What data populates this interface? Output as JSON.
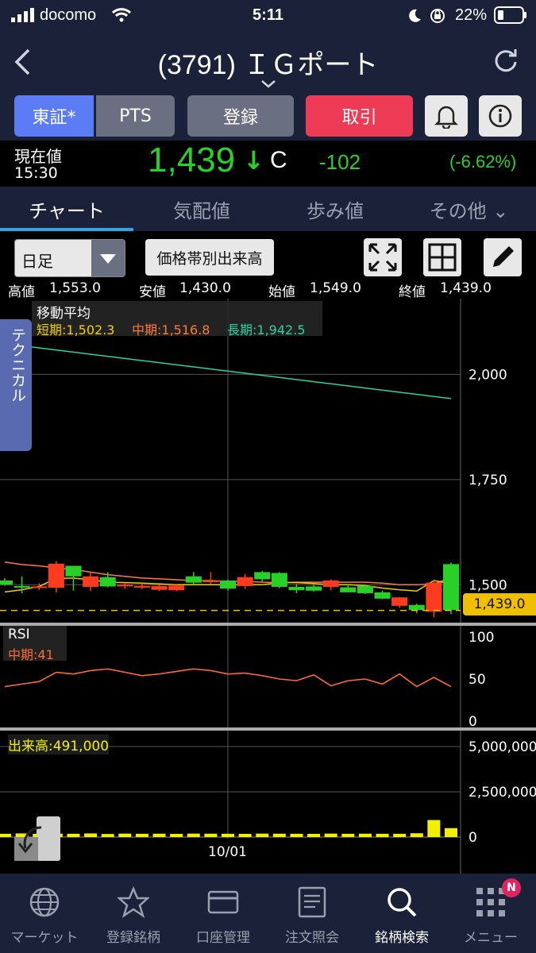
{
  "status": {
    "carrier": "docomo",
    "time": "5:11",
    "battery": "22%"
  },
  "nav": {
    "title": "(3791) ＩＧポート"
  },
  "buttons": {
    "market": "東証*",
    "pts": "PTS",
    "register": "登録",
    "trade": "取引"
  },
  "price": {
    "label": "現在値",
    "time": "15:30",
    "value": "1,439",
    "arrow": "↓",
    "flag": "C",
    "change": "-102",
    "change_pct": "(-6.62%)"
  },
  "tabs": [
    "チャート",
    "気配値",
    "歩み値",
    "その他 ⌄"
  ],
  "toolbar": {
    "period": "日足",
    "volume_profile": "価格帯別出来高"
  },
  "ohlc": {
    "high_label": "高値",
    "high": "1,553.0",
    "low_label": "安値",
    "low": "1,430.0",
    "open_label": "始値",
    "open": "1,549.0",
    "close_label": "終値",
    "close": "1,439.0"
  },
  "technical_tab": "テクニカル",
  "ma": {
    "title": "移動平均",
    "short": "短期:1,502.3",
    "mid": "中期:1,516.8",
    "long": "長期:1,942.5"
  },
  "rsi": {
    "title": "RSI",
    "mid": "中期:41"
  },
  "volume": {
    "label": "出来高:491,000"
  },
  "x_label": "10/01",
  "colors": {
    "up": "#28d028",
    "down": "#ff3b1f",
    "ma_short": "#f0d000",
    "ma_mid": "#ff7a3a",
    "ma_long": "#2ad3a0",
    "rsi": "#ff6a30",
    "volume": "#f0f000",
    "accent": "#5b7cf5",
    "trade": "#ee3b55"
  },
  "chart_data": [
    {
      "type": "candlestick",
      "ylim": [
        1410,
        2180
      ],
      "yticks": [
        "2,000",
        "1,750",
        "1,500"
      ],
      "current_price_label": "1,439.0",
      "candles": [
        {
          "o": 1510,
          "h": 1516,
          "l": 1498,
          "c": 1500,
          "up": true
        },
        {
          "o": 1495,
          "h": 1520,
          "l": 1480,
          "c": 1497,
          "up": true
        },
        {
          "o": 1496,
          "h": 1503,
          "l": 1488,
          "c": 1495,
          "up": false
        },
        {
          "o": 1550,
          "h": 1556,
          "l": 1482,
          "c": 1493,
          "up": false
        },
        {
          "o": 1520,
          "h": 1532,
          "l": 1486,
          "c": 1545,
          "up": true
        },
        {
          "o": 1520,
          "h": 1530,
          "l": 1485,
          "c": 1495,
          "up": false
        },
        {
          "o": 1496,
          "h": 1530,
          "l": 1494,
          "c": 1518,
          "up": true
        },
        {
          "o": 1500,
          "h": 1504,
          "l": 1490,
          "c": 1497,
          "up": false
        },
        {
          "o": 1495,
          "h": 1503,
          "l": 1490,
          "c": 1497,
          "up": false
        },
        {
          "o": 1497,
          "h": 1500,
          "l": 1485,
          "c": 1488,
          "up": false
        },
        {
          "o": 1498,
          "h": 1502,
          "l": 1485,
          "c": 1487,
          "up": false
        },
        {
          "o": 1505,
          "h": 1530,
          "l": 1500,
          "c": 1520,
          "up": true
        },
        {
          "o": 1510,
          "h": 1530,
          "l": 1502,
          "c": 1508,
          "up": false
        },
        {
          "o": 1510,
          "h": 1512,
          "l": 1486,
          "c": 1491,
          "up": true
        },
        {
          "o": 1518,
          "h": 1526,
          "l": 1490,
          "c": 1497,
          "up": false
        },
        {
          "o": 1513,
          "h": 1533,
          "l": 1506,
          "c": 1530,
          "up": true
        },
        {
          "o": 1528,
          "h": 1530,
          "l": 1492,
          "c": 1495,
          "up": true
        },
        {
          "o": 1495,
          "h": 1502,
          "l": 1480,
          "c": 1487,
          "up": true
        },
        {
          "o": 1496,
          "h": 1500,
          "l": 1484,
          "c": 1486,
          "up": true
        },
        {
          "o": 1510,
          "h": 1513,
          "l": 1487,
          "c": 1495,
          "up": false
        },
        {
          "o": 1494,
          "h": 1500,
          "l": 1485,
          "c": 1482,
          "up": true
        },
        {
          "o": 1497,
          "h": 1499,
          "l": 1478,
          "c": 1480,
          "up": true
        },
        {
          "o": 1482,
          "h": 1486,
          "l": 1466,
          "c": 1467,
          "up": true
        },
        {
          "o": 1470,
          "h": 1471,
          "l": 1445,
          "c": 1450,
          "up": false
        },
        {
          "o": 1452,
          "h": 1455,
          "l": 1432,
          "c": 1440,
          "up": true
        },
        {
          "o": 1505,
          "h": 1510,
          "l": 1423,
          "c": 1436,
          "up": false
        },
        {
          "o": 1440,
          "h": 1553,
          "l": 1430,
          "c": 1549,
          "up": true
        }
      ],
      "ma_long_endpoints": [
        2073,
        1942.5
      ],
      "ma_short": [
        1483,
        1488,
        1496,
        1515,
        1516,
        1512,
        1506,
        1505,
        1504,
        1502,
        1500,
        1500,
        1500,
        1500,
        1500,
        1500,
        1505,
        1505,
        1503,
        1500,
        1500,
        1498,
        1492,
        1488,
        1485,
        1510,
        1502.3
      ],
      "ma_mid": [
        1554,
        1548,
        1545,
        1540,
        1536,
        1530,
        1524,
        1520,
        1516,
        1514,
        1512,
        1510,
        1510,
        1508,
        1508,
        1506,
        1505,
        1506,
        1506,
        1506,
        1506,
        1506,
        1504,
        1500,
        1500,
        1502,
        1516.8
      ]
    },
    {
      "type": "line",
      "name": "RSI",
      "ylim": [
        0,
        100
      ],
      "yticks": [
        "100",
        "50",
        "0"
      ],
      "values": [
        41,
        44,
        47,
        58,
        56,
        60,
        62,
        58,
        54,
        56,
        59,
        62,
        60,
        56,
        57,
        54,
        50,
        48,
        55,
        42,
        48,
        50,
        44,
        56,
        41,
        52,
        41
      ]
    },
    {
      "type": "bar",
      "name": "volume",
      "ylim": [
        0,
        5000000
      ],
      "yticks": [
        "5,000,000",
        "2,500,000",
        "0"
      ],
      "values": [
        180000,
        200000,
        180000,
        190000,
        180000,
        200000,
        170000,
        190000,
        180000,
        185000,
        175000,
        190000,
        185000,
        180000,
        175000,
        190000,
        185000,
        180000,
        175000,
        190000,
        180000,
        185000,
        180000,
        180000,
        210000,
        940000,
        491000
      ]
    }
  ],
  "bottom_nav": [
    "マーケット",
    "登録銘柄",
    "口座管理",
    "注文照会",
    "銘柄検索",
    "メニュー"
  ],
  "badge": "N"
}
